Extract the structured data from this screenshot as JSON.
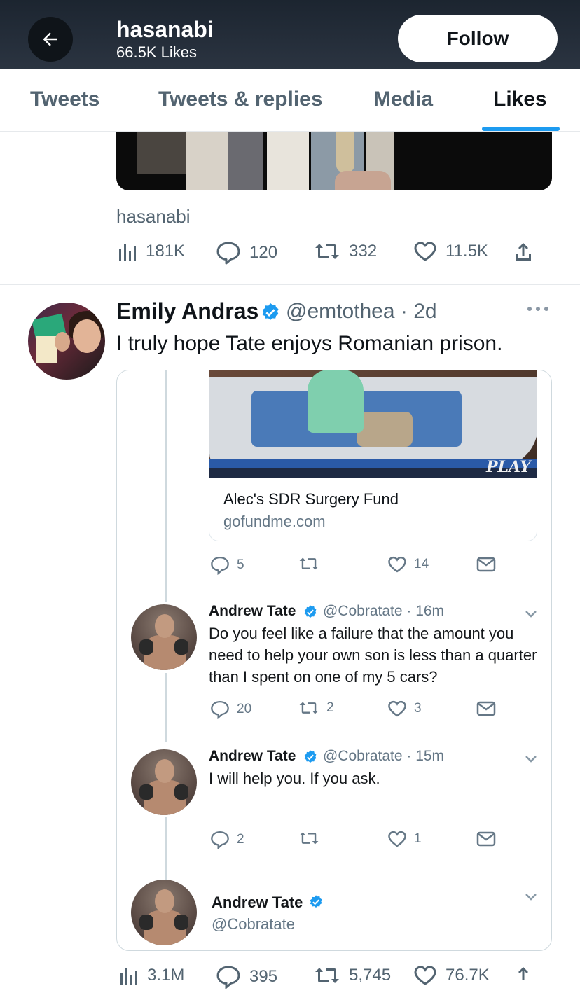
{
  "header": {
    "title": "hasanabi",
    "subtitle": "66.5K Likes",
    "follow_label": "Follow"
  },
  "tabs": [
    {
      "label": "Tweets",
      "active": false
    },
    {
      "label": "Tweets & replies",
      "active": false
    },
    {
      "label": "Media",
      "active": false
    },
    {
      "label": "Likes",
      "active": true
    }
  ],
  "previous_tweet": {
    "author": "hasanabi",
    "views": "181K",
    "replies": "120",
    "retweets": "332",
    "likes": "11.5K"
  },
  "tweet": {
    "name": "Emily Andras",
    "handle": "@emtothea · 2d",
    "text": "I truly hope Tate enjoys Romanian prison.",
    "views": "3.1M",
    "replies": "395",
    "retweets": "5,745",
    "likes": "76.7K"
  },
  "embedded": {
    "card": {
      "image_text": "PLAY",
      "title": "Alec's SDR Surgery Fund",
      "domain": "gofundme.com"
    },
    "card_actions": {
      "replies": "5",
      "retweets": "",
      "likes": "14"
    },
    "replies": [
      {
        "name": "Andrew Tate",
        "handle": "@Cobratate · 16m",
        "text": "Do you feel like a failure that the amount you need to help your own son is less than a quarter than I spent on one of my 5 cars?",
        "replies": "20",
        "retweets": "2",
        "likes": "3"
      },
      {
        "name": "Andrew Tate",
        "handle": "@Cobratate · 15m",
        "text": "I will help you. If you ask.",
        "replies": "2",
        "retweets": "",
        "likes": "1"
      },
      {
        "name": "Andrew Tate",
        "handle": "@Cobratate"
      }
    ]
  },
  "colors": {
    "accent": "#1d9bf0",
    "header_bg": "#222b36",
    "secondary_text": "#536471"
  }
}
